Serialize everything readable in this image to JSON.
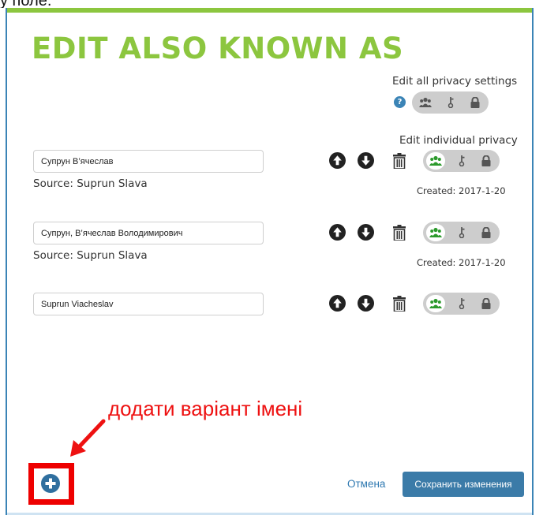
{
  "page_fragment": "у поле.",
  "dialog": {
    "title": "EDIT ALSO KNOWN AS",
    "edit_all_privacy_label": "Edit all privacy settings",
    "edit_individual_privacy_label": "Edit individual privacy",
    "help_icon_glyph": "?",
    "global_privacy": {
      "selected": "none",
      "options": [
        "people-icon",
        "key-icon",
        "lock-icon"
      ]
    }
  },
  "names": [
    {
      "value": "Супрун В’ячеслав",
      "source": "Source: Suprun Slava",
      "created": "Created: 2017-1-20",
      "privacy": "people"
    },
    {
      "value": "Супрун, В’ячеслав Володимирович",
      "source": "Source: Suprun Slava",
      "created": "Created: 2017-1-20",
      "privacy": "people"
    },
    {
      "value": "Suprun Viacheslav",
      "source": "",
      "created": "",
      "privacy": "people"
    }
  ],
  "annotation": {
    "text": "додати варіант імені",
    "color": "#ee1111"
  },
  "footer": {
    "cancel_label": "Отмена",
    "save_label": "Сохранить изменения"
  },
  "colors": {
    "accent_green": "#8cc63f",
    "frame_blue": "#3b84b6",
    "save_button": "#3b7ba8",
    "active_people": "#2c9a2c"
  }
}
